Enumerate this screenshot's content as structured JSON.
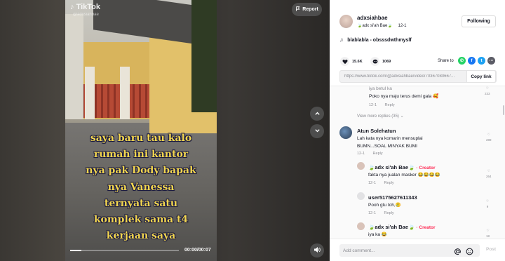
{
  "video": {
    "watermark": "TikTok",
    "watermark_handle": "@adxsiahbae",
    "caption_lines": [
      "saya baru tau kalo",
      "rumah ini kantor",
      "nya pak Dody bapak",
      "nya Vanessa",
      "ternyata satu",
      "komplek sama t4",
      "kerjaan saya"
    ],
    "time": "00:00/00:07",
    "progress": 0.1,
    "report_label": "Report"
  },
  "author": {
    "username": "adxsiahbae",
    "nickname": "adx si'ah Bae",
    "date": "12-1",
    "follow_label": "Following"
  },
  "music": "blablabla - obsssdwthmyslf",
  "stats": {
    "likes": "15.6K",
    "comments": "1069",
    "share_label": "Share to"
  },
  "link": {
    "url": "https://www.tiktok.com/@adxsiahbae/video/70367080667...",
    "copy_label": "Copy link"
  },
  "comments": {
    "top_reply": {
      "text1": "iya betul ka",
      "text2": "Poko nya maju terus demi gala 🥰",
      "date": "12-1",
      "reply_label": "Reply",
      "likes": "233"
    },
    "view_more": "View more replies (35)",
    "items": [
      {
        "name": "Atun Solehatun",
        "text1": "Lah kata nya komarin mensuplai",
        "text2": "BUMN...SOAL MINYAK BUMI",
        "date": "12-1",
        "reply_label": "Reply",
        "likes": "289"
      },
      {
        "name": "adx si'ah Bae",
        "creator": "Creator",
        "text": "fakta nya jualan masker 😂😂😂😂",
        "date": "12-1",
        "reply_label": "Reply",
        "likes": "264"
      },
      {
        "name": "user5175627611343",
        "text": "Pooh gtu toh,🥲",
        "date": "12-1",
        "reply_label": "Reply",
        "likes": "9"
      },
      {
        "name": "adx si'ah Bae",
        "creator": "Creator",
        "text": "iya ka 😂",
        "likes": "18"
      }
    ]
  },
  "input": {
    "placeholder": "Add comment...",
    "post_label": "Post"
  }
}
